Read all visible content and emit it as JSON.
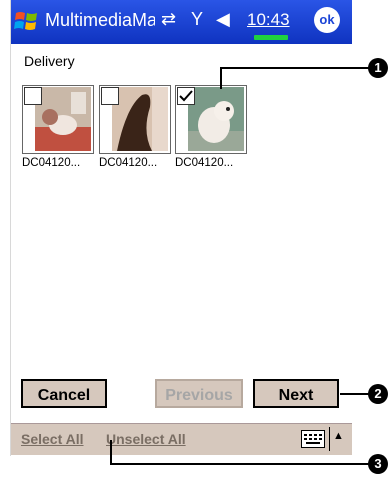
{
  "titlebar": {
    "app_title": "MultimediaMa",
    "time": "10:43",
    "ok_label": "ok"
  },
  "folder": {
    "label": "Delivery"
  },
  "thumbnails": [
    {
      "caption": "DC04120...",
      "checked": false
    },
    {
      "caption": "DC04120...",
      "checked": false
    },
    {
      "caption": "DC04120...",
      "checked": true
    }
  ],
  "buttons": {
    "cancel": "Cancel",
    "previous": "Previous",
    "next": "Next"
  },
  "bottom_bar": {
    "select_all": "Select All",
    "unselect_all": "Unselect All"
  },
  "callouts": [
    "1",
    "2",
    "3"
  ],
  "colors": {
    "titlebar": "#1b44d6",
    "button_face": "#d6c8bd",
    "battery": "#20d040"
  }
}
